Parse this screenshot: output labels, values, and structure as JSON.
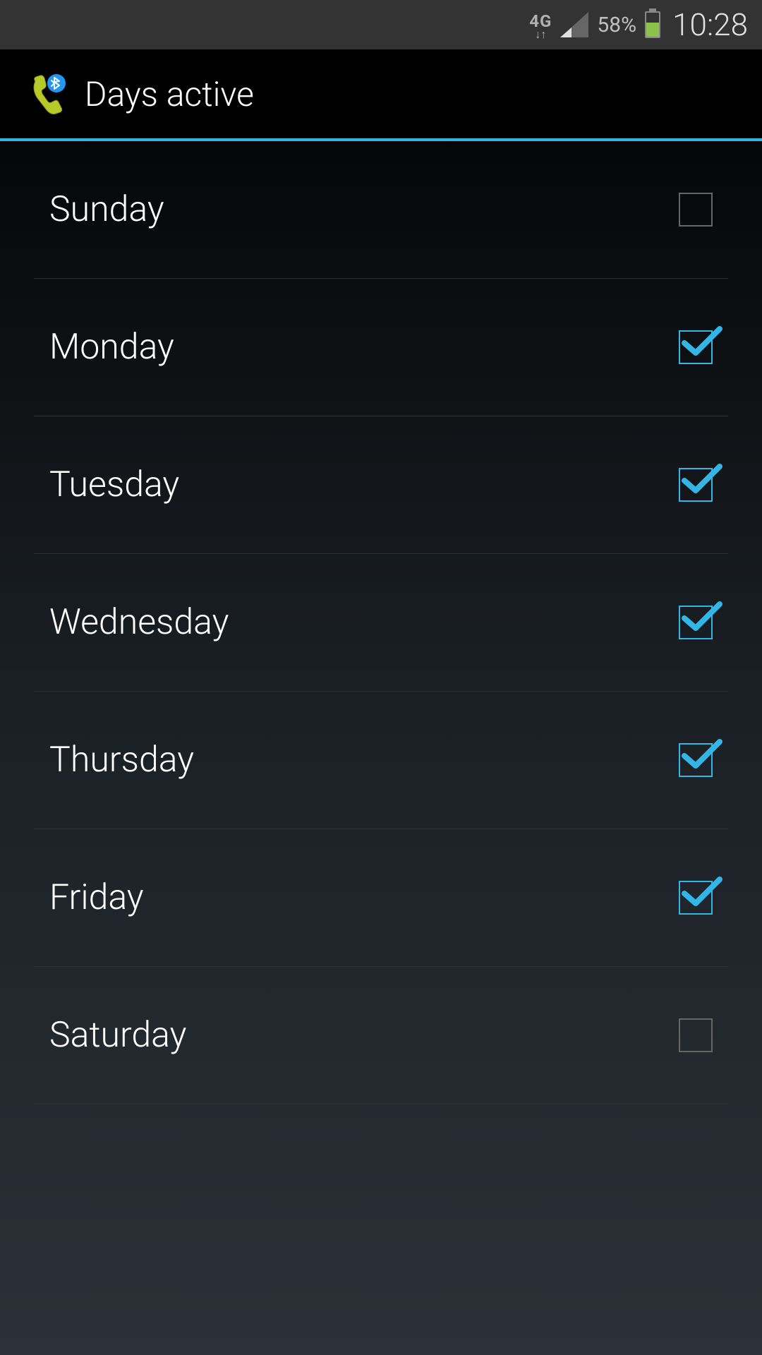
{
  "statusBar": {
    "networkType": "4G",
    "batteryPercent": "58%",
    "time": "10:28"
  },
  "actionBar": {
    "title": "Days active"
  },
  "days": {
    "0": {
      "label": "Sunday",
      "checked": false
    },
    "1": {
      "label": "Monday",
      "checked": true
    },
    "2": {
      "label": "Tuesday",
      "checked": true
    },
    "3": {
      "label": "Wednesday",
      "checked": true
    },
    "4": {
      "label": "Thursday",
      "checked": true
    },
    "5": {
      "label": "Friday",
      "checked": true
    },
    "6": {
      "label": "Saturday",
      "checked": false
    }
  }
}
